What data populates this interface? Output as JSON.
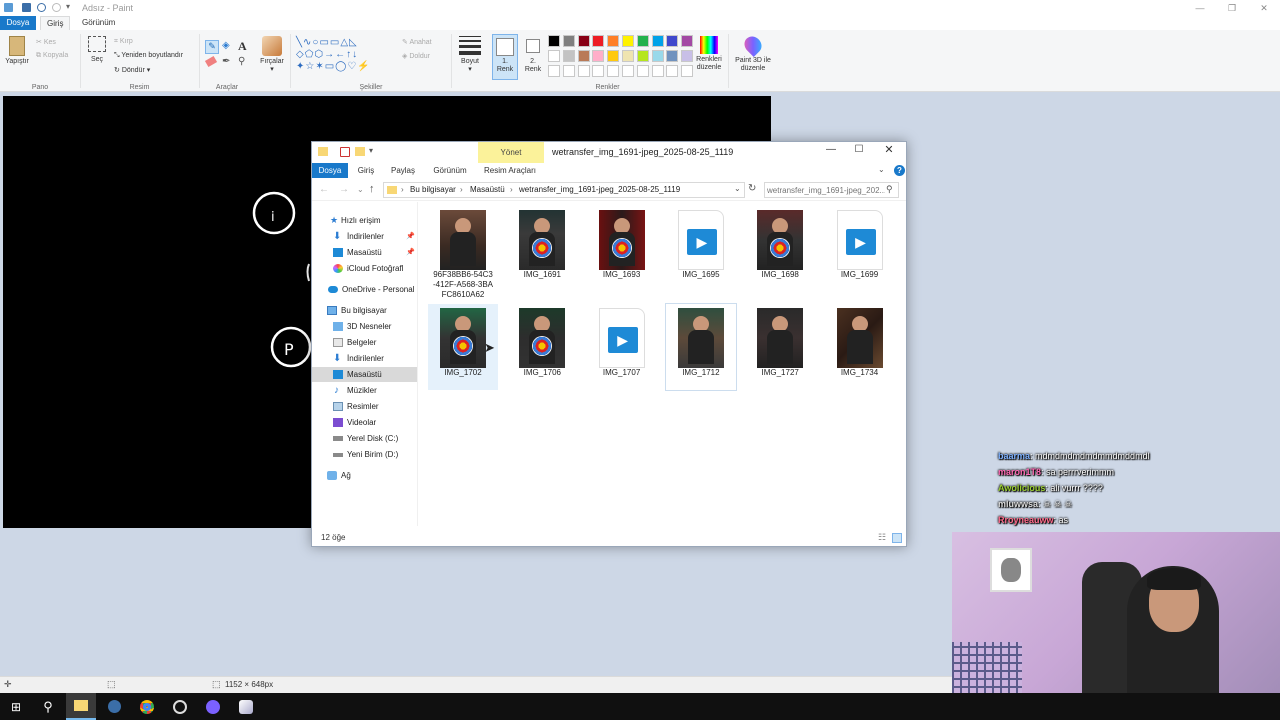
{
  "paint": {
    "title": "Adsız - Paint",
    "tabs": [
      "Dosya",
      "Giriş",
      "Görünüm"
    ],
    "clipboard": {
      "paste": "Yapıştır",
      "cut": "Kes",
      "copy": "Kopyala",
      "group": "Pano"
    },
    "image": {
      "select": "Seç",
      "crop": "Kırp",
      "resize": "Yeniden boyutlandır",
      "rotate": "Döndür",
      "group": "Resim"
    },
    "tools_group": "Araçlar",
    "brushes": "Fırçalar",
    "shapes": {
      "outline": "Anahat",
      "fill": "Doldur",
      "group": "Şekiller"
    },
    "size": "Boyut",
    "color1": "1. Renk",
    "color2": "2. Renk",
    "edit_colors": "Renkleri düzenle",
    "paint3d": "Paint 3D ile düzenle",
    "colors_group": "Renkler",
    "palette": [
      "#000000",
      "#7f7f7f",
      "#880015",
      "#ed1c24",
      "#ff7f27",
      "#fff200",
      "#22b14c",
      "#00a2e8",
      "#3f48cc",
      "#a349a4",
      "#ffffff",
      "#c3c3c3",
      "#b97a57",
      "#ffaec9",
      "#ffc90e",
      "#efe4b0",
      "#b5e61d",
      "#99d9ea",
      "#7092be",
      "#c8bfe7"
    ],
    "canvas_size": "1152 × 648px",
    "canvas_letters": [
      "i",
      "P"
    ]
  },
  "explorer": {
    "manage": "Yönet",
    "title": "wetransfer_img_1691-jpeg_2025-08-25_1119",
    "tabs": [
      "Dosya",
      "Giriş",
      "Paylaş",
      "Görünüm",
      "Resim Araçları"
    ],
    "breadcrumb": [
      "Bu bilgisayar",
      "Masaüstü",
      "wetransfer_img_1691-jpeg_2025-08-25_1119"
    ],
    "search_placeholder": "wetransfer_img_1691-jpeg_202...",
    "nav": {
      "quick_access": "Hızlı erişim",
      "downloads": "İndirilenler",
      "desktop": "Masaüstü",
      "icloud": "iCloud Fotoğrafl",
      "onedrive": "OneDrive - Personal",
      "this_pc": "Bu bilgisayar",
      "objects3d": "3D Nesneler",
      "documents": "Belgeler",
      "downloads2": "İndirilenler",
      "desktop2": "Masaüstü",
      "music": "Müzikler",
      "pictures": "Resimler",
      "videos": "Videolar",
      "local_disk": "Yerel Disk (C:)",
      "new_volume": "Yeni Birim (D:)",
      "network": "Ağ"
    },
    "files": [
      {
        "name": "96F38BB6-54C3-412F-A568-3BAFC8610A62",
        "kind": "photo"
      },
      {
        "name": "IMG_1691",
        "kind": "photo"
      },
      {
        "name": "IMG_1693",
        "kind": "photo"
      },
      {
        "name": "IMG_1695",
        "kind": "video"
      },
      {
        "name": "IMG_1698",
        "kind": "photo"
      },
      {
        "name": "IMG_1699",
        "kind": "video"
      },
      {
        "name": "IMG_1702",
        "kind": "photo"
      },
      {
        "name": "IMG_1706",
        "kind": "photo"
      },
      {
        "name": "IMG_1707",
        "kind": "video"
      },
      {
        "name": "IMG_1712",
        "kind": "photo"
      },
      {
        "name": "IMG_1727",
        "kind": "photo"
      },
      {
        "name": "IMG_1734",
        "kind": "photo"
      }
    ],
    "status": "12 öğe"
  },
  "chat": [
    {
      "user": "baarma",
      "text": "mdmdmdmdmdmmdmddmdl",
      "color": "#7fb2ff"
    },
    {
      "user": "maron1T8",
      "text": "sa perrrverimmm",
      "color": "#ff69b4"
    },
    {
      "user": "Awolicious",
      "text": "ali vurrr ????",
      "color": "#9acd32"
    },
    {
      "user": "mluwwsa",
      "text": "☠ ☠ ☠",
      "color": "#dddddd"
    },
    {
      "user": "Rroyneauww",
      "text": "as",
      "color": "#ff6b8b"
    }
  ]
}
